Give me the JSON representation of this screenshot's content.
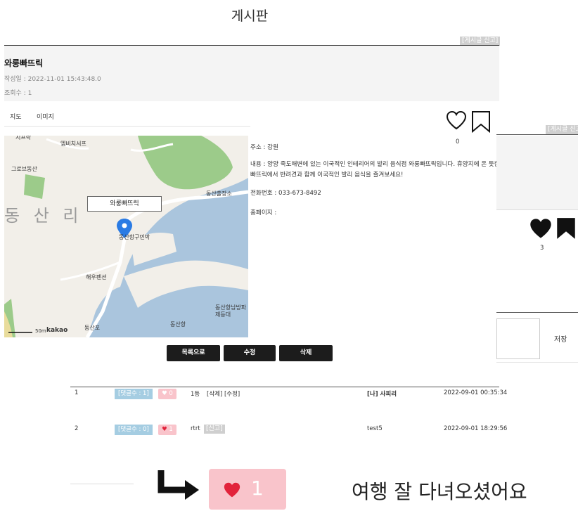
{
  "page": {
    "title": "게시판"
  },
  "report_label": "[게시글 신고]",
  "post": {
    "title": "와룽빠뜨릭",
    "date": "작성일 : 2022-11-01 15:43:48.0",
    "views": "조회수 : 1",
    "like_count": "0"
  },
  "tabs": [
    {
      "label": "지도"
    },
    {
      "label": "이미지"
    }
  ],
  "map": {
    "callout": "와룽빠뜨릭",
    "region_label": "동 산 리",
    "labels": [
      "엠비치서프",
      "그로브동산",
      "동산출장소",
      "동산항구민박",
      "해우펜션",
      "동산항남방파제등대",
      "동산항",
      "동산포",
      "지프락"
    ],
    "scale": "50m",
    "brand": "kakao"
  },
  "info": {
    "address": "주소 : 강원",
    "content_line1": "내용 : 양양 죽도해변에 있는 이국적인 인테리어의 발리 음식점 와룽빠뜨릭입니다. 휴양지에 온 듯한 와룽",
    "content_line2": "빠뜨릭에서 반려견과 함께 이국적인 발리 음식을 즐겨보세요!",
    "phone": "전화번호 : 033-673-8492",
    "homepage": "홈페이지 :"
  },
  "buttons": {
    "list": "목록으로",
    "edit": "수정",
    "delete": "삭제"
  },
  "overlay": {
    "report_label": "[게시글 신고]",
    "like_count": "3"
  },
  "comment_form": {
    "save_label": "저장"
  },
  "comments": [
    {
      "no": "1",
      "reply_count": "[댓글수 : 1]",
      "likes": "0",
      "text": "1등",
      "actions": "[삭제] [수정]",
      "author": "[나] 사피리",
      "date": "2022-09-01 00:35:34"
    },
    {
      "no": "2",
      "reply_count": "[댓글수 : 0]",
      "likes": "1",
      "text": "rtrt",
      "report": "[신고]",
      "author": "test5",
      "date": "2022-09-01 18:29:56"
    }
  ],
  "zoom": {
    "likes": "1",
    "text": "여행 잘 다녀오셨어요"
  },
  "colors": {
    "accent_dark": "#1c1c1c",
    "like_pink": "#f9c4cb",
    "count_blue": "#a5cde2",
    "heart_red": "#e2233b"
  }
}
